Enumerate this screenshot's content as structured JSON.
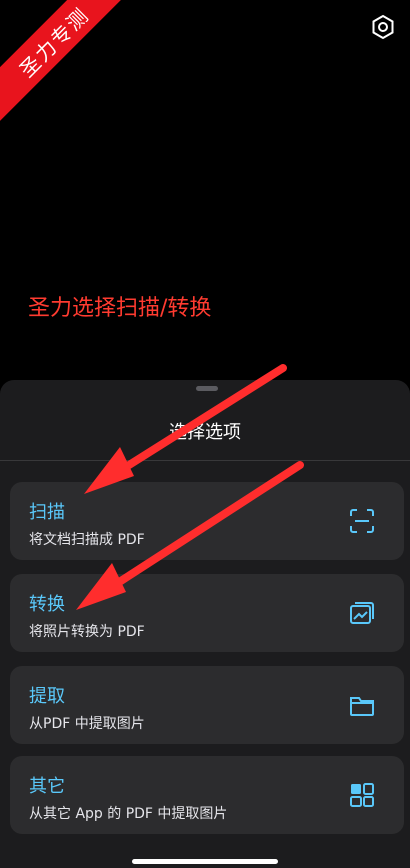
{
  "watermark": {
    "text": "圣力专测"
  },
  "hint": {
    "text": "圣力选择扫描/转换"
  },
  "sheet": {
    "title": "选择选项",
    "options": [
      {
        "title": "扫描",
        "subtitle": "将文档扫描成 PDF",
        "icon": "scan-frame-icon"
      },
      {
        "title": "转换",
        "subtitle": "将照片转换为 PDF",
        "icon": "photo-stack-icon"
      },
      {
        "title": "提取",
        "subtitle": "从PDF 中提取图片",
        "icon": "folder-icon"
      },
      {
        "title": "其它",
        "subtitle": "从其它 App 的 PDF 中提取图片",
        "icon": "grid-icon"
      }
    ]
  },
  "colors": {
    "accent": "#5ac8fa",
    "annotation": "#ff3b30",
    "sheet": "#1c1c1e",
    "card": "#2c2c2e"
  }
}
